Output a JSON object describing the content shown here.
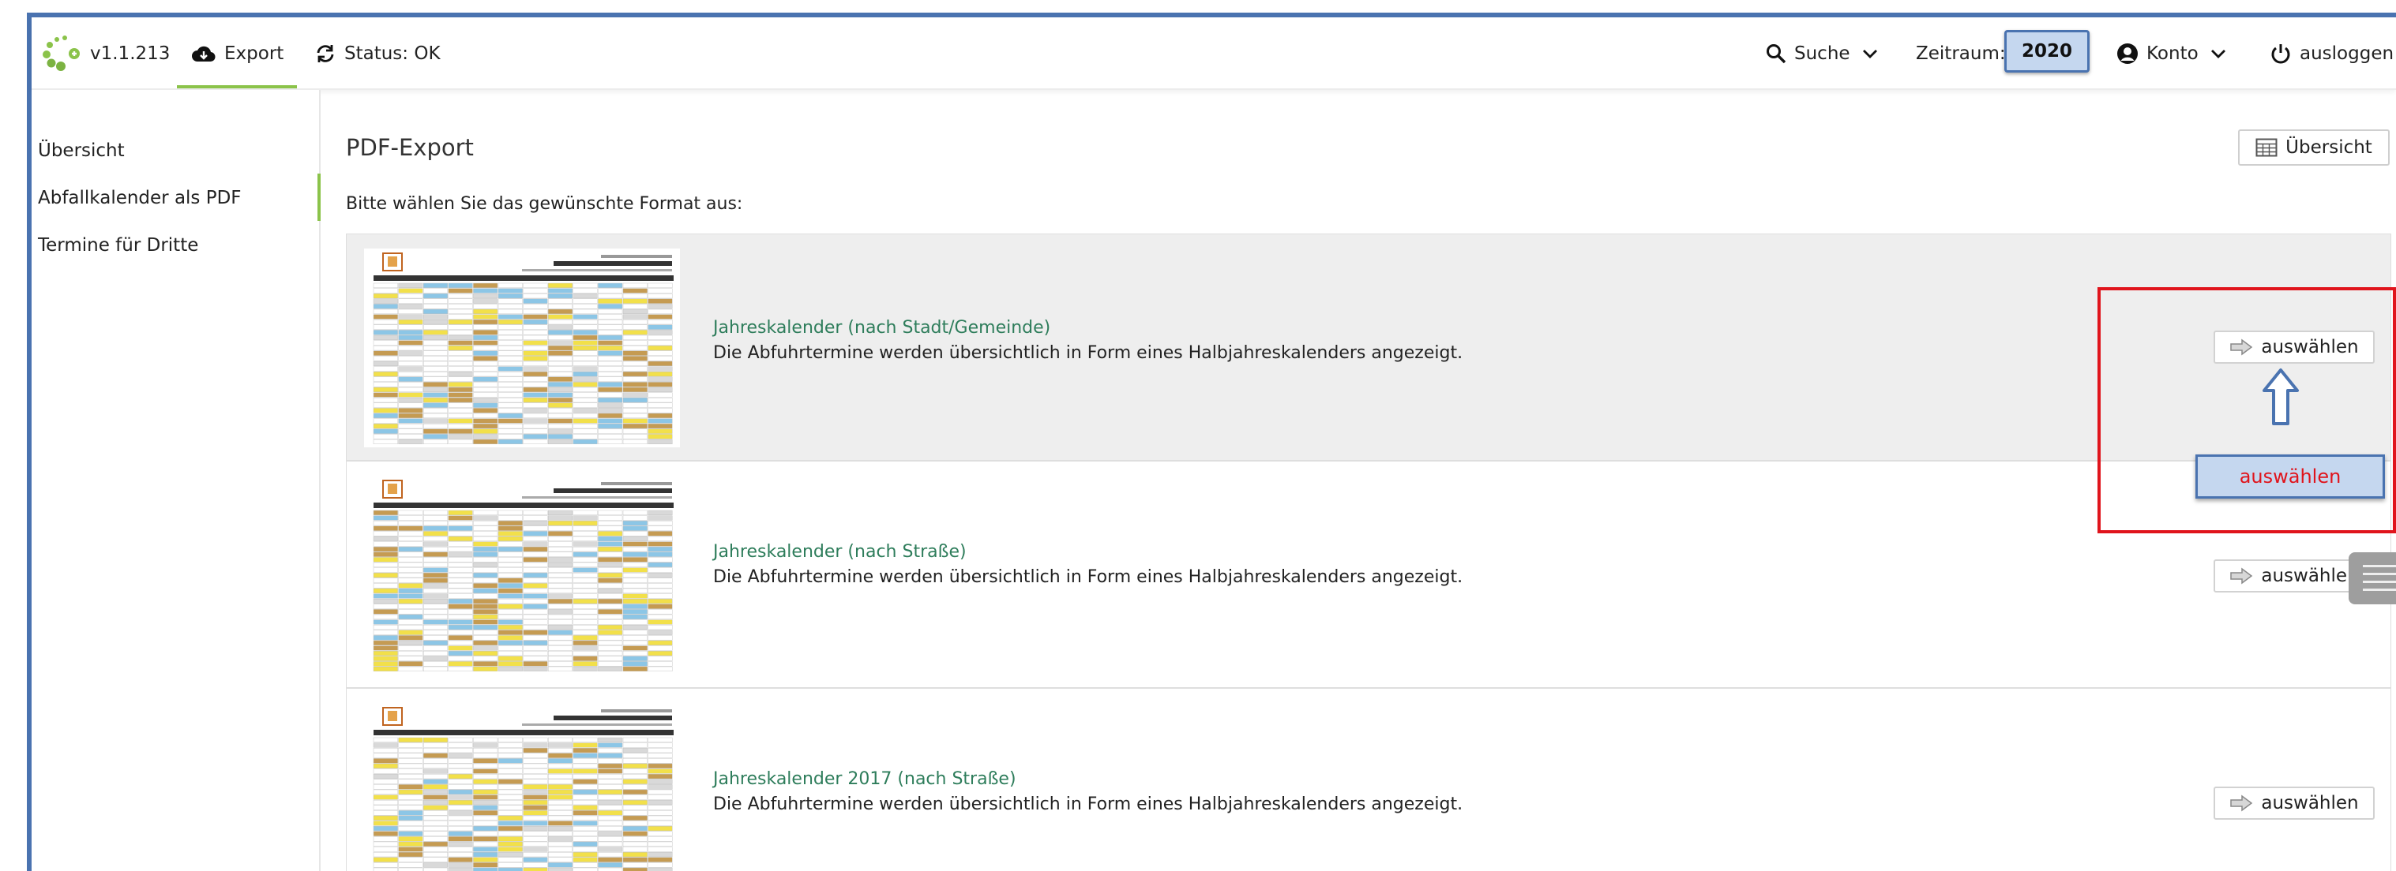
{
  "navbar": {
    "version": "v1.1.213",
    "export_label": "Export",
    "status_label": "Status: OK",
    "search_label": "Suche",
    "period_label": "Zeitraum:",
    "period_value": "2020",
    "account_label": "Konto",
    "logout_label": "ausloggen",
    "accent_color": "#8bc34a"
  },
  "sidebar": {
    "items": [
      {
        "label": "Übersicht"
      },
      {
        "label": "Abfallkalender als PDF"
      },
      {
        "label": "Termine für Dritte"
      }
    ]
  },
  "main": {
    "title": "PDF-Export",
    "overview_button": "Übersicht",
    "intro": "Bitte wählen Sie das gewünschte Format aus:",
    "formats": [
      {
        "title": "Jahreskalender (nach Stadt/Gemeinde)",
        "description": "Die Abfuhrtermine werden übersichtlich in Form eines Halbjahreskalenders angezeigt.",
        "button": "auswählen"
      },
      {
        "title": "Jahreskalender (nach Straße)",
        "description": "Die Abfuhrtermine werden übersichtlich in Form eines Halbjahreskalenders angezeigt.",
        "button": "auswählen"
      },
      {
        "title": "Jahreskalender 2017 (nach Straße)",
        "description": "Die Abfuhrtermine werden übersichtlich in Form eines Halbjahreskalenders angezeigt.",
        "button": "auswählen"
      }
    ]
  },
  "annotation": {
    "callout_label": "auswählen",
    "highlight_color": "#e0141c"
  },
  "icons": [
    "logo-icon",
    "cloud-download-icon",
    "refresh-icon",
    "search-icon",
    "chevron-down-icon",
    "user-circle-icon",
    "power-icon",
    "table-icon",
    "arrow-right-icon",
    "up-arrow-icon"
  ]
}
